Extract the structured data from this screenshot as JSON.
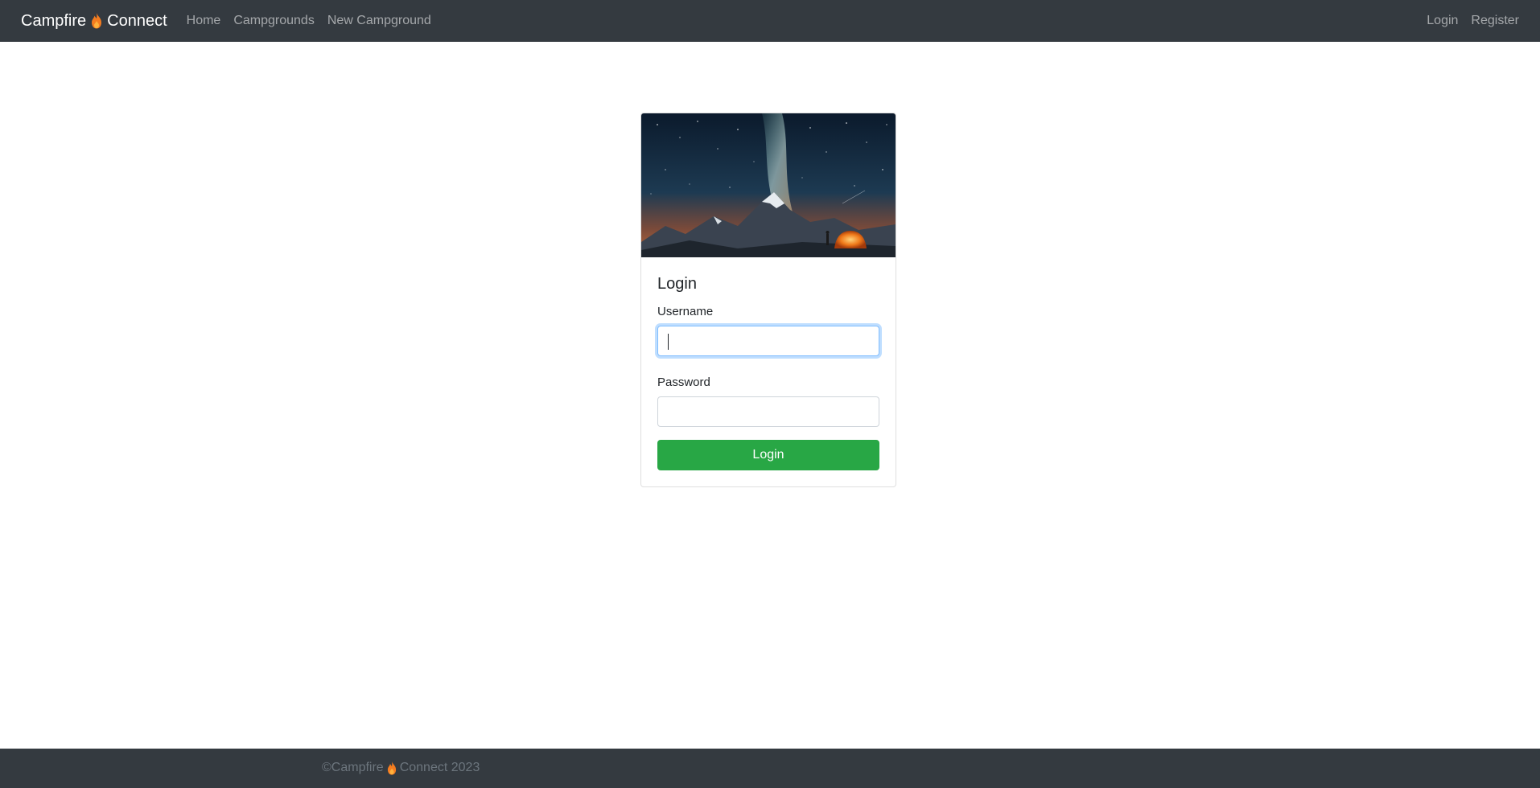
{
  "navbar": {
    "brand_left": "Campfire",
    "brand_right": "Connect",
    "brand_icon": "flame-icon",
    "links": [
      {
        "label": "Home"
      },
      {
        "label": "Campgrounds"
      },
      {
        "label": "New Campground"
      }
    ],
    "right_links": [
      {
        "label": "Login"
      },
      {
        "label": "Register"
      }
    ]
  },
  "login_card": {
    "title": "Login",
    "username_label": "Username",
    "username_value": "",
    "password_label": "Password",
    "password_value": "",
    "submit_label": "Login"
  },
  "footer": {
    "prefix": "©Campfire",
    "suffix": "Connect 2023"
  },
  "colors": {
    "navbar_bg": "#343a40",
    "success": "#28a745",
    "flame": "#f47c20"
  }
}
